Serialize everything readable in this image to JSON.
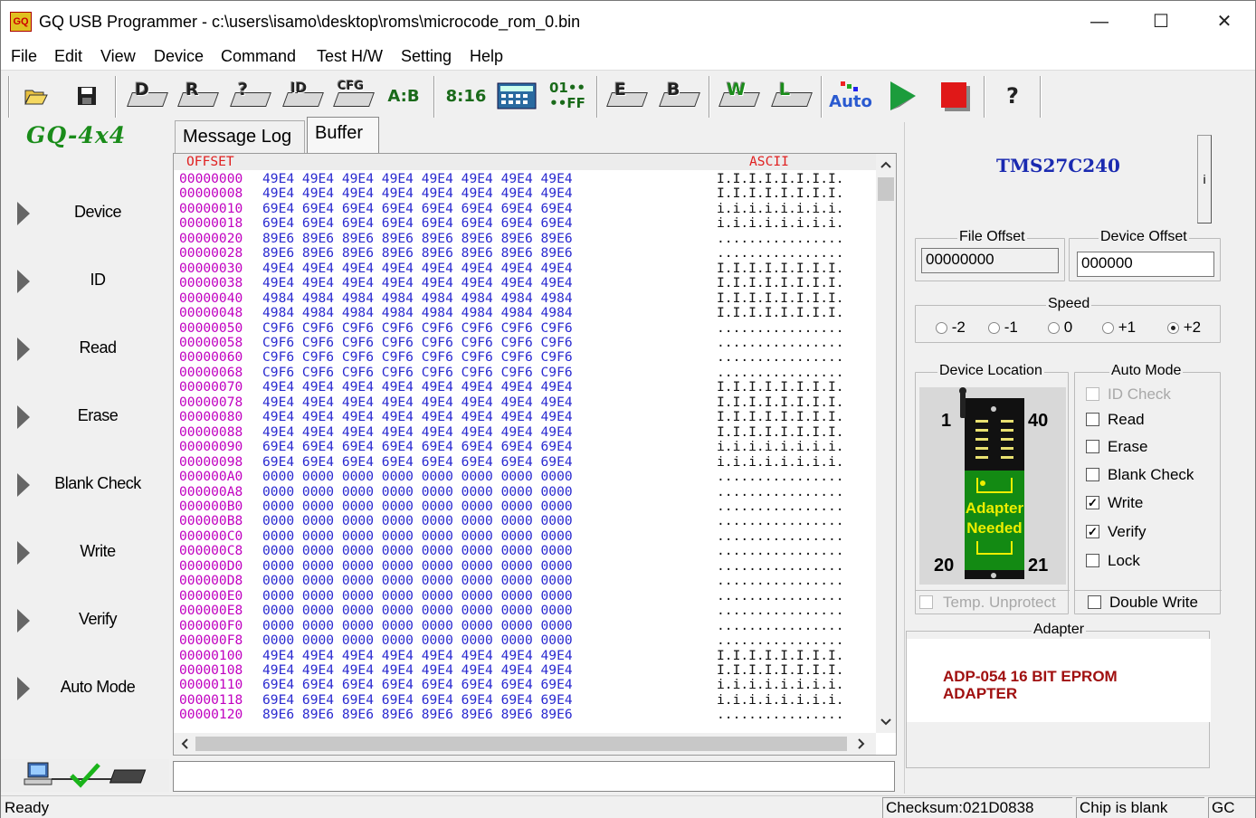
{
  "window": {
    "title": "GQ USB Programmer - c:\\users\\isamo\\desktop\\roms\\microcode_rom_0.bin",
    "icon_text": "GQ",
    "minimize": "—",
    "maximize": "☐",
    "close": "✕"
  },
  "menu": [
    "File",
    "Edit",
    "View",
    "Device",
    "Command",
    "Test H/W",
    "Setting",
    "Help"
  ],
  "toolbar": {
    "open_icon": "folder-open-icon",
    "save_icon": "floppy-save-icon",
    "d": "D",
    "r": "R",
    "v": "?",
    "id": "ID",
    "cfg": "CFG",
    "swap": "A:B",
    "swap16": "8:16",
    "fill": "01••",
    "fill2": "••FF",
    "e": "E",
    "b": "B",
    "w": "W",
    "l": "L",
    "auto": "Auto",
    "help": "?"
  },
  "logo": "GQ-4x4",
  "sidebar": [
    "Device",
    "ID",
    "Read",
    "Erase",
    "Blank Check",
    "Write",
    "Verify",
    "Auto Mode"
  ],
  "tabs": [
    "Message Log",
    "Buffer"
  ],
  "buffer": {
    "offset_header": "OFFSET",
    "ascii_header": "ASCII",
    "offsets": [
      "00000000",
      "00000008",
      "00000010",
      "00000018",
      "00000020",
      "00000028",
      "00000030",
      "00000038",
      "00000040",
      "00000048",
      "00000050",
      "00000058",
      "00000060",
      "00000068",
      "00000070",
      "00000078",
      "00000080",
      "00000088",
      "00000090",
      "00000098",
      "000000A0",
      "000000A8",
      "000000B0",
      "000000B8",
      "000000C0",
      "000000C8",
      "000000D0",
      "000000D8",
      "000000E0",
      "000000E8",
      "000000F0",
      "000000F8",
      "00000100",
      "00000108",
      "00000110",
      "00000118",
      "00000120"
    ],
    "hex": [
      "49E4 49E4 49E4 49E4 49E4 49E4 49E4 49E4",
      "49E4 49E4 49E4 49E4 49E4 49E4 49E4 49E4",
      "69E4 69E4 69E4 69E4 69E4 69E4 69E4 69E4",
      "69E4 69E4 69E4 69E4 69E4 69E4 69E4 69E4",
      "89E6 89E6 89E6 89E6 89E6 89E6 89E6 89E6",
      "89E6 89E6 89E6 89E6 89E6 89E6 89E6 89E6",
      "49E4 49E4 49E4 49E4 49E4 49E4 49E4 49E4",
      "49E4 49E4 49E4 49E4 49E4 49E4 49E4 49E4",
      "4984 4984 4984 4984 4984 4984 4984 4984",
      "4984 4984 4984 4984 4984 4984 4984 4984",
      "C9F6 C9F6 C9F6 C9F6 C9F6 C9F6 C9F6 C9F6",
      "C9F6 C9F6 C9F6 C9F6 C9F6 C9F6 C9F6 C9F6",
      "C9F6 C9F6 C9F6 C9F6 C9F6 C9F6 C9F6 C9F6",
      "C9F6 C9F6 C9F6 C9F6 C9F6 C9F6 C9F6 C9F6",
      "49E4 49E4 49E4 49E4 49E4 49E4 49E4 49E4",
      "49E4 49E4 49E4 49E4 49E4 49E4 49E4 49E4",
      "49E4 49E4 49E4 49E4 49E4 49E4 49E4 49E4",
      "49E4 49E4 49E4 49E4 49E4 49E4 49E4 49E4",
      "69E4 69E4 69E4 69E4 69E4 69E4 69E4 69E4",
      "69E4 69E4 69E4 69E4 69E4 69E4 69E4 69E4",
      "0000 0000 0000 0000 0000 0000 0000 0000",
      "0000 0000 0000 0000 0000 0000 0000 0000",
      "0000 0000 0000 0000 0000 0000 0000 0000",
      "0000 0000 0000 0000 0000 0000 0000 0000",
      "0000 0000 0000 0000 0000 0000 0000 0000",
      "0000 0000 0000 0000 0000 0000 0000 0000",
      "0000 0000 0000 0000 0000 0000 0000 0000",
      "0000 0000 0000 0000 0000 0000 0000 0000",
      "0000 0000 0000 0000 0000 0000 0000 0000",
      "0000 0000 0000 0000 0000 0000 0000 0000",
      "0000 0000 0000 0000 0000 0000 0000 0000",
      "0000 0000 0000 0000 0000 0000 0000 0000",
      "49E4 49E4 49E4 49E4 49E4 49E4 49E4 49E4",
      "49E4 49E4 49E4 49E4 49E4 49E4 49E4 49E4",
      "69E4 69E4 69E4 69E4 69E4 69E4 69E4 69E4",
      "69E4 69E4 69E4 69E4 69E4 69E4 69E4 69E4",
      "89E6 89E6 89E6 89E6 89E6 89E6 89E6 89E6"
    ],
    "ascii": [
      "I.I.I.I.I.I.I.I.",
      "I.I.I.I.I.I.I.I.",
      "i.i.i.i.i.i.i.i.",
      "i.i.i.i.i.i.i.i.",
      "................",
      "................",
      "I.I.I.I.I.I.I.I.",
      "I.I.I.I.I.I.I.I.",
      "I.I.I.I.I.I.I.I.",
      "I.I.I.I.I.I.I.I.",
      "................",
      "................",
      "................",
      "................",
      "I.I.I.I.I.I.I.I.",
      "I.I.I.I.I.I.I.I.",
      "I.I.I.I.I.I.I.I.",
      "I.I.I.I.I.I.I.I.",
      "i.i.i.i.i.i.i.i.",
      "i.i.i.i.i.i.i.i.",
      "................",
      "................",
      "................",
      "................",
      "................",
      "................",
      "................",
      "................",
      "................",
      "................",
      "................",
      "................",
      "I.I.I.I.I.I.I.I.",
      "I.I.I.I.I.I.I.I.",
      "i.i.i.i.i.i.i.i.",
      "i.i.i.i.i.i.i.i.",
      "................"
    ]
  },
  "device": {
    "name": "TMS27C240",
    "info_btn": "i",
    "file_offset_label": "File Offset",
    "file_offset": "00000000",
    "device_offset_label": "Device Offset",
    "device_offset": "000000",
    "speed_label": "Speed",
    "speeds": [
      "-2",
      "-1",
      "0",
      "+1",
      "+2"
    ],
    "speed_selected": "+2",
    "location_label": "Device Location",
    "pin_tl": "1",
    "pin_tr": "40",
    "pin_bl": "20",
    "pin_br": "21",
    "adapter_text1": "Adapter",
    "adapter_text2": "Needed",
    "temp_unprotect": "Temp. Unprotect"
  },
  "automode": {
    "label": "Auto Mode",
    "items": [
      {
        "label": "ID Check",
        "checked": false,
        "disabled": true
      },
      {
        "label": "Read",
        "checked": false,
        "disabled": false
      },
      {
        "label": "Erase",
        "checked": false,
        "disabled": false
      },
      {
        "label": "Blank Check",
        "checked": false,
        "disabled": false
      },
      {
        "label": "Write",
        "checked": true,
        "disabled": false
      },
      {
        "label": "Verify",
        "checked": true,
        "disabled": false
      },
      {
        "label": "Lock",
        "checked": false,
        "disabled": false
      }
    ],
    "double_write": "Double Write"
  },
  "adapter": {
    "label": "Adapter",
    "line1": "ADP-054 16 BIT EPROM",
    "line2": "ADAPTER"
  },
  "status": {
    "ready": "Ready",
    "checksum": "Checksum:021D0838",
    "chip": "Chip is blank",
    "gc": "GC"
  },
  "colors": {
    "offset": "#c000c0",
    "hex": "#2a2ad0",
    "accent_green": "#1a8c1a",
    "adapter_red": "#a01010",
    "chip_green": "#138a13"
  }
}
